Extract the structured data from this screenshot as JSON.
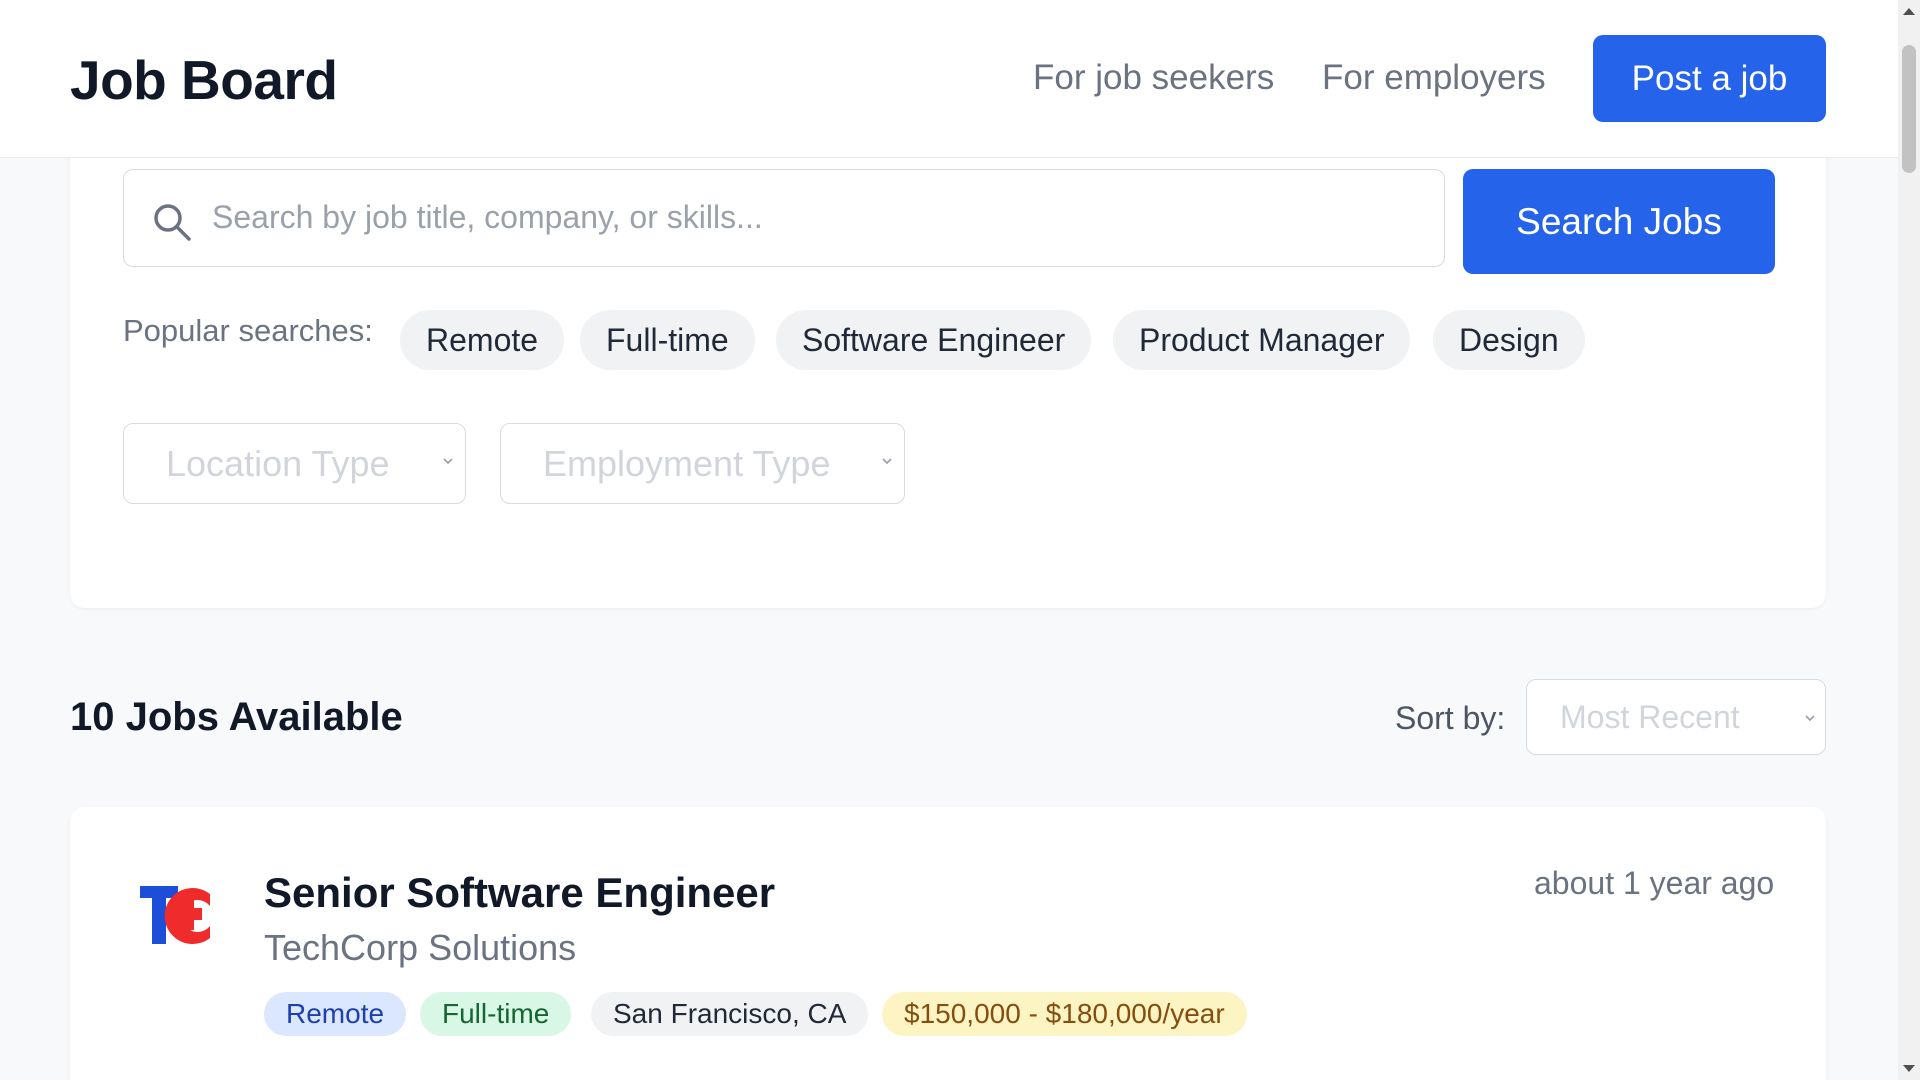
{
  "header": {
    "logo": "Job Board",
    "nav": {
      "job_seekers": "For job seekers",
      "employers": "For employers"
    },
    "post_job_label": "Post a job"
  },
  "search": {
    "placeholder": "Search by job title, company, or skills...",
    "value": "",
    "button_label": "Search Jobs",
    "popular_label": "Popular searches:",
    "popular": [
      "Remote",
      "Full-time",
      "Software Engineer",
      "Product Manager",
      "Design"
    ],
    "location_select": "Location Type",
    "employment_select": "Employment Type"
  },
  "results": {
    "count_label": "10 Jobs Available",
    "sort_label": "Sort by:",
    "sort_value": "Most Recent"
  },
  "jobs": [
    {
      "title": "Senior Software Engineer",
      "company": "TechCorp Solutions",
      "posted": "about 1 year ago",
      "tags": {
        "location_type": "Remote",
        "employment_type": "Full-time",
        "location": "San Francisco, CA",
        "salary": "$150,000 - $180,000/year"
      },
      "logo_icon": "techcorp-logo"
    }
  ],
  "colors": {
    "primary": "#2563eb",
    "background": "#f8f9fb",
    "remote_tag": "#dbe7fe",
    "fulltime_tag": "#d9f7e5",
    "salary_tag": "#fdf4c4"
  }
}
